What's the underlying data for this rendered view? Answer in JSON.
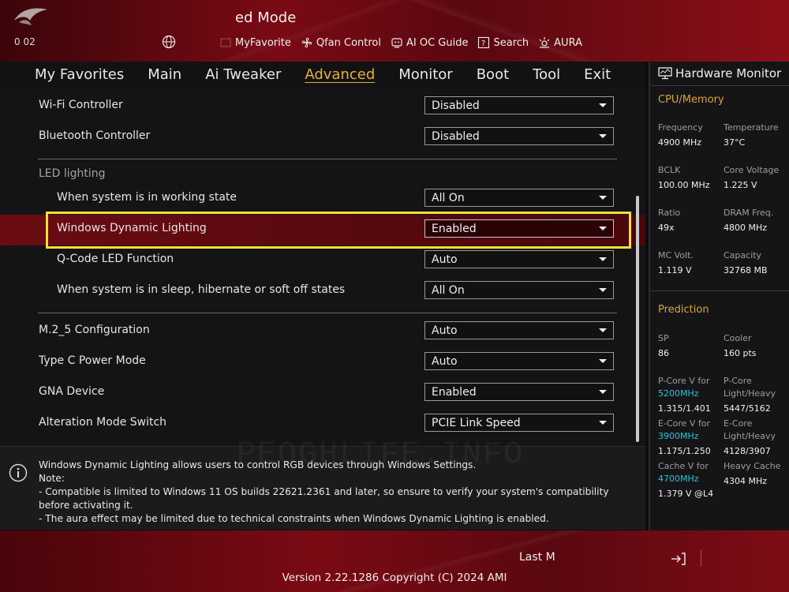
{
  "header": {
    "mode_title": "ed Mode",
    "date_text": "0   02",
    "nav": [
      {
        "label": "MyFavorite",
        "icon": "favorite-icon"
      },
      {
        "label": "Qfan Control",
        "icon": "fan-icon"
      },
      {
        "label": "AI OC Guide",
        "icon": "ai-guide-icon"
      },
      {
        "label": "Search",
        "icon": "search-icon"
      },
      {
        "label": "AURA",
        "icon": "aura-icon"
      }
    ]
  },
  "menu": {
    "tabs": [
      "My Favorites",
      "Main",
      "Ai Tweaker",
      "Advanced",
      "Monitor",
      "Boot",
      "Tool",
      "Exit"
    ],
    "active": "Advanced"
  },
  "settings": {
    "wifi": {
      "label": "Wi-Fi Controller",
      "value": "Disabled"
    },
    "bluetooth": {
      "label": "Bluetooth Controller",
      "value": "Disabled"
    },
    "led_section": "LED lighting",
    "working_state": {
      "label": "When system is in working state",
      "value": "All On"
    },
    "dynamic_lighting": {
      "label": "Windows Dynamic Lighting",
      "value": "Enabled"
    },
    "qcode": {
      "label": "Q-Code LED Function",
      "value": "Auto"
    },
    "sleep_state": {
      "label": "When system is in sleep, hibernate or soft off states",
      "value": "All On"
    },
    "m2_5": {
      "label": "M.2_5 Configuration",
      "value": "Auto"
    },
    "typec": {
      "label": "Type C Power Mode",
      "value": "Auto"
    },
    "gna": {
      "label": "GNA Device",
      "value": "Enabled"
    },
    "alteration": {
      "label": "Alteration Mode Switch",
      "value": "PCIE Link Speed"
    }
  },
  "help": {
    "watermark": "PEOGHLIFE.INFO",
    "line1": "Windows Dynamic Lighting allows users to control RGB devices through Windows Settings.",
    "line2": "Note:",
    "line3": "- Compatible is limited to Windows 11 OS builds 22621.2361 and later, so ensure to verify your system's compatibility before activating it.",
    "line4": "- The aura effect may be limited due to technical constraints when Windows Dynamic Lighting is enabled."
  },
  "hw": {
    "title": "Hardware Monitor",
    "cpu_section": "CPU/Memory",
    "frequency": {
      "k": "Frequency",
      "v": "4900 MHz"
    },
    "temperature": {
      "k": "Temperature",
      "v": "37°C"
    },
    "bclk": {
      "k": "BCLK",
      "v": "100.00 MHz"
    },
    "core_voltage": {
      "k": "Core Voltage",
      "v": "1.225 V"
    },
    "ratio": {
      "k": "Ratio",
      "v": "49x"
    },
    "dram_freq": {
      "k": "DRAM Freq.",
      "v": "4800 MHz"
    },
    "mc_volt": {
      "k": "MC Volt.",
      "v": "1.119 V"
    },
    "capacity": {
      "k": "Capacity",
      "v": "32768 MB"
    },
    "prediction_section": "Prediction",
    "sp": {
      "k": "SP",
      "v": "86"
    },
    "cooler": {
      "k": "Cooler",
      "v": "160 pts"
    },
    "pcore_v": {
      "k": "P-Core V for",
      "c": "5200MHz",
      "v": "1.315/1.401"
    },
    "pcore_lh": {
      "k1": "P-Core",
      "k2": "Light/Heavy",
      "v": "5447/5162"
    },
    "ecore_v": {
      "k": "E-Core V for",
      "c": "3900MHz",
      "v": "1.175/1.250"
    },
    "ecore_lh": {
      "k1": "E-Core",
      "k2": "Light/Heavy",
      "v": "4128/3907"
    },
    "cache_v": {
      "k": "Cache V for",
      "c": "4700MHz",
      "v": "1.379 V @L4"
    },
    "heavy_cache": {
      "k": "Heavy Cache",
      "v": "4304 MHz"
    }
  },
  "footer": {
    "last_modified": "Last M",
    "version": "Version 2.22.1286 Copyright (C) 2024 AMI"
  }
}
